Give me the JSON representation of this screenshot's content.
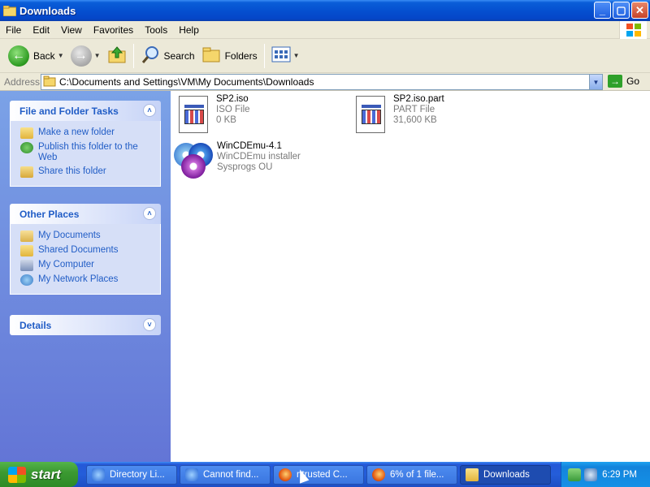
{
  "window": {
    "title": "Downloads",
    "buttons": {
      "minimize": "_",
      "maximize": "▢",
      "close": "✕"
    }
  },
  "menu": [
    "File",
    "Edit",
    "View",
    "Favorites",
    "Tools",
    "Help"
  ],
  "toolbar": {
    "back": "Back",
    "search": "Search",
    "folders": "Folders"
  },
  "address": {
    "label": "Address",
    "value": "C:\\Documents and Settings\\VM\\My Documents\\Downloads",
    "go": "Go"
  },
  "tasks_panel": {
    "title": "File and Folder Tasks",
    "items": [
      "Make a new folder",
      "Publish this folder to the Web",
      "Share this folder"
    ]
  },
  "places_panel": {
    "title": "Other Places",
    "items": [
      "My Documents",
      "Shared Documents",
      "My Computer",
      "My Network Places"
    ]
  },
  "details_panel": {
    "title": "Details"
  },
  "files": [
    {
      "name": "SP2.iso",
      "type": "ISO File",
      "detail": "0 KB",
      "icon": "generic-file-icon"
    },
    {
      "name": "SP2.iso.part",
      "type": "PART File",
      "detail": "31,600 KB",
      "icon": "generic-file-icon"
    },
    {
      "name": "WinCDEmu-4.1",
      "type": "WinCDEmu installer",
      "detail": "Sysprogs OU",
      "icon": "cd-installer-icon"
    }
  ],
  "taskbar": {
    "start": "start",
    "tasks": [
      {
        "label": "Directory Li...",
        "icon": "ie-icon"
      },
      {
        "label": "Cannot find...",
        "icon": "ie-icon"
      },
      {
        "label": "ntrusted C...",
        "icon": "firefox-icon"
      },
      {
        "label": "6% of 1 file...",
        "icon": "firefox-icon"
      },
      {
        "label": "Downloads",
        "icon": "folder-icon"
      }
    ],
    "clock": "6:29 PM"
  },
  "colors": {
    "titlebar": "#0550d0",
    "sidebar_gradient_top": "#7ba2e7",
    "sidebar_gradient_bottom": "#6375d6",
    "link": "#215dc6",
    "start_green": "#3c9a32"
  }
}
